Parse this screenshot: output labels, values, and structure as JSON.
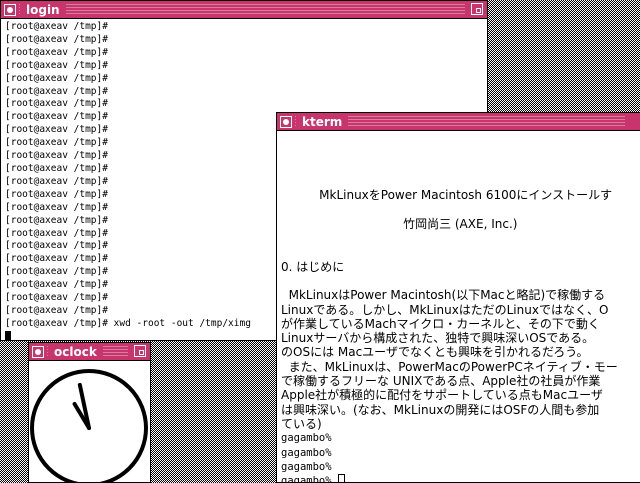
{
  "windows": {
    "login": {
      "title": "login",
      "lines": [
        "[root@axeav /tmp]#",
        "[root@axeav /tmp]#",
        "[root@axeav /tmp]#",
        "[root@axeav /tmp]#",
        "[root@axeav /tmp]#",
        "[root@axeav /tmp]#",
        "[root@axeav /tmp]#",
        "[root@axeav /tmp]#",
        "[root@axeav /tmp]#",
        "[root@axeav /tmp]#",
        "[root@axeav /tmp]#",
        "[root@axeav /tmp]#",
        "[root@axeav /tmp]#",
        "[root@axeav /tmp]#",
        "[root@axeav /tmp]#",
        "[root@axeav /tmp]#",
        "[root@axeav /tmp]#",
        "[root@axeav /tmp]#",
        "[root@axeav /tmp]#",
        "[root@axeav /tmp]#",
        "[root@axeav /tmp]#",
        "[root@axeav /tmp]#",
        "[root@axeav /tmp]#",
        "[root@axeav /tmp]# xwd -root -out /tmp/ximg"
      ]
    },
    "kterm": {
      "title": "kterm",
      "lines": [
        "",
        "",
        "",
        "",
        "          MkLinuxをPower Macintosh 6100にインストールす",
        "",
        "                                竹岡尚三 (AXE, Inc.)",
        "",
        "",
        "0. はじめに",
        "",
        "  MkLinuxはPower Macintosh(以下Macと略記)で稼働する",
        "Linuxである。しかし、MkLinuxはただのLinuxではなく、O",
        "が作業しているMachマイクロ・カーネルと、その下で動く",
        "Linuxサーバから構成された、独特で興味深いOSである。",
        "のOSには Macユーザでなくとも興味を引かれるだろう。",
        "  また、MkLinuxは、PowerMacのPowerPCネイティブ・モー",
        "で稼働するフリーな UNIXである点、Apple社の社員が作業",
        "Apple社が積極的に配付をサポートしている点もMacユーザ",
        "は興味深い。(なお、MkLinuxの開発にはOSFの人間も参加",
        "ている)"
      ],
      "prompts": [
        "gagambo%",
        "gagambo%",
        "gagambo%",
        "gagambo%"
      ]
    },
    "oclock": {
      "title": "oclock",
      "time": {
        "hour": 10,
        "minute": 58
      }
    }
  }
}
